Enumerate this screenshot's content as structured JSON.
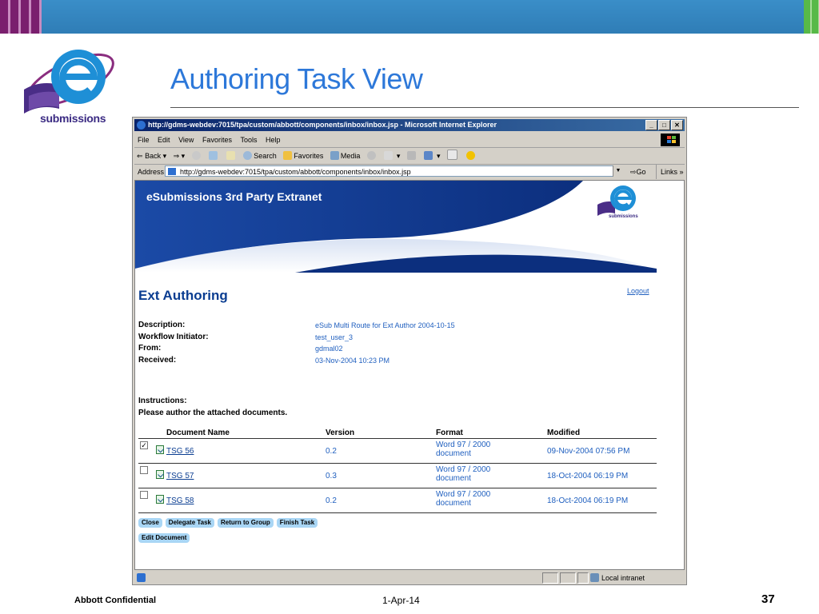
{
  "slide": {
    "title": "Authoring Task View",
    "logo_text": "submissions",
    "footer_left": "Abbott Confidential",
    "footer_date": "1-Apr-14",
    "page_number": "37"
  },
  "browser": {
    "title": "http://gdms-webdev:7015/tpa/custom/abbott/components/inbox/inbox.jsp - Microsoft Internet Explorer",
    "menu": [
      "File",
      "Edit",
      "View",
      "Favorites",
      "Tools",
      "Help"
    ],
    "toolbar": {
      "back": "Back",
      "search": "Search",
      "favorites": "Favorites",
      "media": "Media"
    },
    "address_label": "Address",
    "address_value": "http://gdms-webdev:7015/tpa/custom/abbott/components/inbox/inbox.jsp",
    "go": "Go",
    "links": "Links",
    "status_zone": "Local intranet"
  },
  "page": {
    "banner_title": "eSubmissions 3rd Party Extranet",
    "mini_logo_text": "submissions",
    "heading": "Ext Authoring",
    "logout": "Logout",
    "meta_labels": [
      "Description:",
      "Workflow Initiator:",
      "From:",
      "Received:"
    ],
    "meta_values": [
      "eSub Multi Route for Ext Author 2004-10-15",
      "test_user_3",
      "gdmal02",
      "03-Nov-2004 10:23 PM"
    ],
    "instructions_label": "Instructions:",
    "instructions_text": "Please author the attached documents.",
    "table": {
      "headers": [
        "Document Name",
        "Version",
        "Format",
        "Modified"
      ],
      "rows": [
        {
          "checked": "✓",
          "name": "TSG 56",
          "version": "0.2",
          "format": "Word 97 / 2000 document",
          "modified": "09-Nov-2004 07:56 PM"
        },
        {
          "checked": "",
          "name": "TSG 57",
          "version": "0.3",
          "format": "Word 97 / 2000 document",
          "modified": "18-Oct-2004 06:19 PM"
        },
        {
          "checked": "",
          "name": "TSG 58",
          "version": "0.2",
          "format": "Word 97 / 2000 document",
          "modified": "18-Oct-2004 06:19 PM"
        }
      ]
    },
    "buttons": [
      "Close",
      "Delegate Task",
      "Return to Group",
      "Finish Task"
    ],
    "buttons_row2": [
      "Edit Document"
    ]
  },
  "colors": {
    "accent_blue": "#2d78d9",
    "link_blue": "#1f5fbf",
    "heading_navy": "#0a3d91",
    "button_bg": "#a9d6f5"
  }
}
